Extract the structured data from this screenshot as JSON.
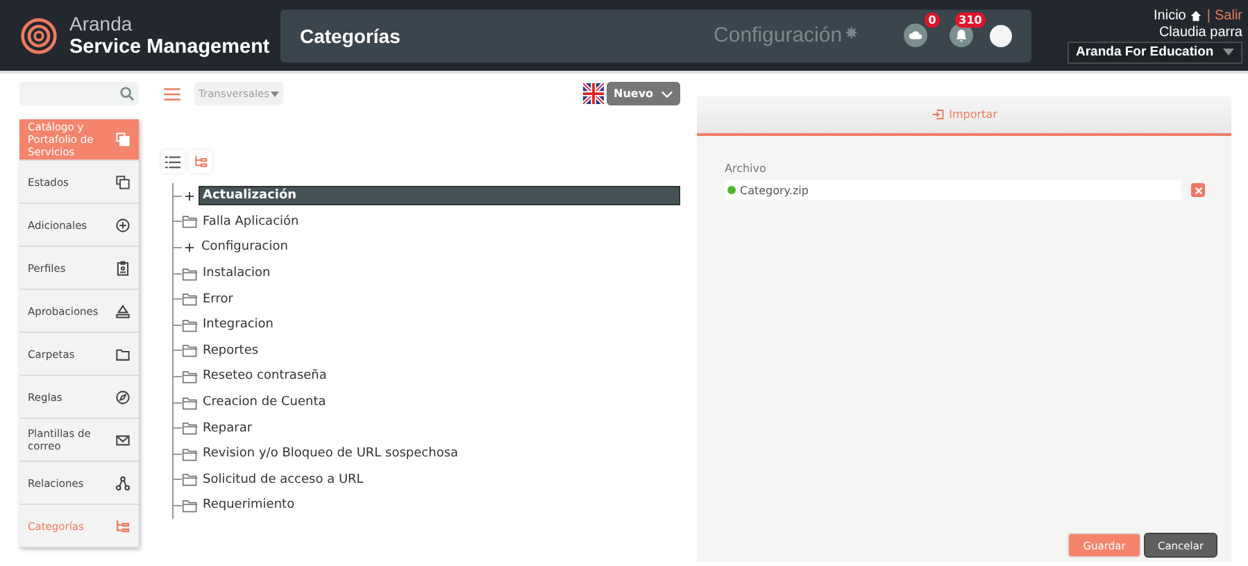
{
  "header": {
    "brand_top": "Aranda",
    "brand_bottom": "Service Management",
    "page_title": "Categorías",
    "section": "Configuración",
    "cloud_badge": "0",
    "bell_badge": "310",
    "home_link": "Inicio",
    "separator": "|",
    "logout_link": "Salir",
    "user": "Claudia parra",
    "project": "Aranda For Education"
  },
  "sidebar": {
    "items": [
      {
        "label": "Catálogo y Portafolio de Servicios",
        "kind": "group",
        "selected": false
      },
      {
        "label": "Estados",
        "kind": "item",
        "selected": false
      },
      {
        "label": "Adicionales",
        "kind": "item",
        "selected": false
      },
      {
        "label": "Perfiles",
        "kind": "item",
        "selected": false
      },
      {
        "label": "Aprobaciones",
        "kind": "item",
        "selected": false
      },
      {
        "label": "Carpetas",
        "kind": "item",
        "selected": false
      },
      {
        "label": "Reglas",
        "kind": "item",
        "selected": false
      },
      {
        "label": "Plantillas de correo",
        "kind": "item",
        "selected": false
      },
      {
        "label": "Relaciones",
        "kind": "item",
        "selected": false
      },
      {
        "label": "Categorías",
        "kind": "item",
        "selected": true
      }
    ]
  },
  "toolbar": {
    "filter": "Transversales",
    "new_button": "Nuevo"
  },
  "view_toggle": [
    {
      "kind": "list",
      "selected": false
    },
    {
      "kind": "tree",
      "selected": true
    }
  ],
  "tree": [
    {
      "label": "Actualización",
      "kind": "expandable",
      "selected": true
    },
    {
      "label": "Falla Aplicación",
      "kind": "leaf",
      "selected": false
    },
    {
      "label": "Configuracion",
      "kind": "expandable",
      "selected": false
    },
    {
      "label": "Instalacion",
      "kind": "leaf",
      "selected": false
    },
    {
      "label": "Error",
      "kind": "leaf",
      "selected": false
    },
    {
      "label": "Integracion",
      "kind": "leaf",
      "selected": false
    },
    {
      "label": "Reportes",
      "kind": "leaf",
      "selected": false
    },
    {
      "label": "Reseteo contraseña",
      "kind": "leaf",
      "selected": false
    },
    {
      "label": "Creacion de Cuenta",
      "kind": "leaf",
      "selected": false
    },
    {
      "label": "Reparar",
      "kind": "leaf",
      "selected": false
    },
    {
      "label": "Revision y/o Bloqueo de URL sospechosa",
      "kind": "leaf",
      "selected": false
    },
    {
      "label": "Solicitud de acceso a URL",
      "kind": "leaf",
      "selected": false
    },
    {
      "label": "Requerimiento",
      "kind": "leaf",
      "selected": false
    }
  ],
  "import_panel": {
    "tab": "Importar",
    "file_label": "Archivo",
    "file_name": "Category.zip",
    "file_uploaded": true,
    "save_button": "Guardar",
    "cancel_button": "Cancelar"
  }
}
